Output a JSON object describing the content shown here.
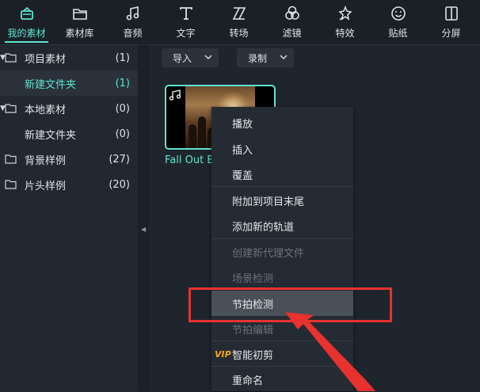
{
  "toolbar": {
    "items": [
      {
        "label": "我的素材",
        "icon": "my-media-icon",
        "active": true
      },
      {
        "label": "素材库",
        "icon": "folder-icon"
      },
      {
        "label": "音频",
        "icon": "music-note-icon"
      },
      {
        "label": "文字",
        "icon": "text-icon"
      },
      {
        "label": "转场",
        "icon": "transition-icon"
      },
      {
        "label": "滤镜",
        "icon": "filter-icon"
      },
      {
        "label": "特效",
        "icon": "effects-star-icon"
      },
      {
        "label": "贴纸",
        "icon": "sticker-icon"
      },
      {
        "label": "分屏",
        "icon": "split-screen-icon"
      }
    ]
  },
  "sidebar": {
    "items": [
      {
        "name": "项目素材",
        "count": "(1)",
        "expanded": true
      },
      {
        "name": "新建文件夹",
        "count": "(1)",
        "selected": true
      },
      {
        "name": "本地素材",
        "count": "(0)",
        "expanded": true
      },
      {
        "name": "新建文件夹",
        "count": "(0)"
      },
      {
        "name": "背景样例",
        "count": "(27)"
      },
      {
        "name": "片头样例",
        "count": "(20)"
      }
    ]
  },
  "main": {
    "import_label": "导入",
    "record_label": "录制",
    "media": {
      "filename": "Fall Out B"
    }
  },
  "context_menu": {
    "items": [
      {
        "label": "播放"
      },
      {
        "label": "插入"
      },
      {
        "label": "覆盖"
      },
      {
        "label": "附加到项目末尾"
      },
      {
        "label": "添加新的轨道"
      },
      {
        "label": "创建新代理文件",
        "disabled": true
      },
      {
        "label": "场景检测",
        "disabled": true
      },
      {
        "label": "节拍检测",
        "highlighted": true
      },
      {
        "label": "节拍编辑",
        "disabled": true
      },
      {
        "label": "智能初剪",
        "badge": "VIP"
      },
      {
        "label": "重命名"
      }
    ]
  },
  "colors": {
    "accent": "#5fe3cf",
    "annotation": "#e8322f",
    "vip": "#f3a41e"
  }
}
